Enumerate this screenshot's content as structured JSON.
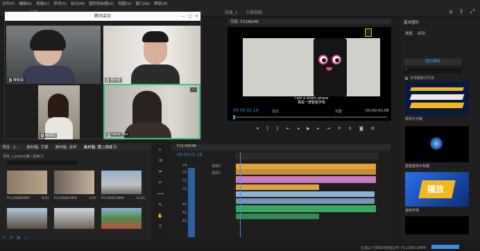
{
  "menu": [
    "文件(F)",
    "编辑(E)",
    "剪辑(C)",
    "序列(S)",
    "标记(M)",
    "图形和标题(G)",
    "视图(V)",
    "窗口(W)",
    "帮助(H)"
  ],
  "workspace": {
    "left_tab": "编辑",
    "center_tab": "效果_1",
    "center_tab2": "三维视图"
  },
  "meeting": {
    "title": "腾讯会议",
    "participants": [
      {
        "name": "黎悦语"
      },
      {
        "name": "杨可雯"
      },
      {
        "name": "韩明阳"
      },
      {
        "name": "Irene Fëu"
      }
    ]
  },
  "program_monitor": {
    "title": "节目: F1296/48",
    "subtitle_line1": "I am a smart phone",
    "subtitle_line2": "我是一部智能手机",
    "timecode": "00:00:01:19",
    "fit_label": "适合",
    "quality_label": "完整",
    "duration": "00:00:41:08"
  },
  "graphics_panel": {
    "title": "基本图形",
    "tabs": [
      "浏览",
      "编辑"
    ],
    "my_templates": "我的模板",
    "local_templates_checkbox": "本地模板文件夹",
    "checkbox2": "库",
    "templates": [
      {
        "label": "现代计分板"
      },
      {
        "label": "旅游宣传片标题"
      },
      {
        "label": "播放",
        "label_caption": "游戏开场"
      }
    ]
  },
  "project_panel": {
    "tabs": [
      "项目: 上...",
      "素材箱: 字幕",
      "素材箱: 采样",
      "素材箱: 第二段练习"
    ],
    "path": "项目_1.prproj\\第二段练习",
    "clips": [
      {
        "name": "P1139681MP4",
        "duration": "9:23"
      },
      {
        "name": "P1139681MP4",
        "duration": "3:02"
      },
      {
        "name": "P1139611MP4",
        "duration": "13:01"
      },
      {
        "name": "",
        "duration": ""
      },
      {
        "name": "",
        "duration": ""
      },
      {
        "name": "",
        "duration": ""
      }
    ]
  },
  "timeline": {
    "title": "P1139648",
    "timecode": "00:00:01:19",
    "tracks": [
      "V4",
      "V3",
      "V2",
      "V1",
      "A1",
      "A2",
      "A3"
    ],
    "track_names": [
      "视频4",
      "视频3"
    ]
  },
  "status": {
    "text": "生成以下项目的峰值文件: P1139671MP4"
  },
  "colors": {
    "accent": "#3b8ee8",
    "clip_orange": "#e1a23a",
    "clip_pink": "#c77cc2",
    "clip_blue": "#8fb1d6",
    "audio_green": "#3aa55f"
  }
}
